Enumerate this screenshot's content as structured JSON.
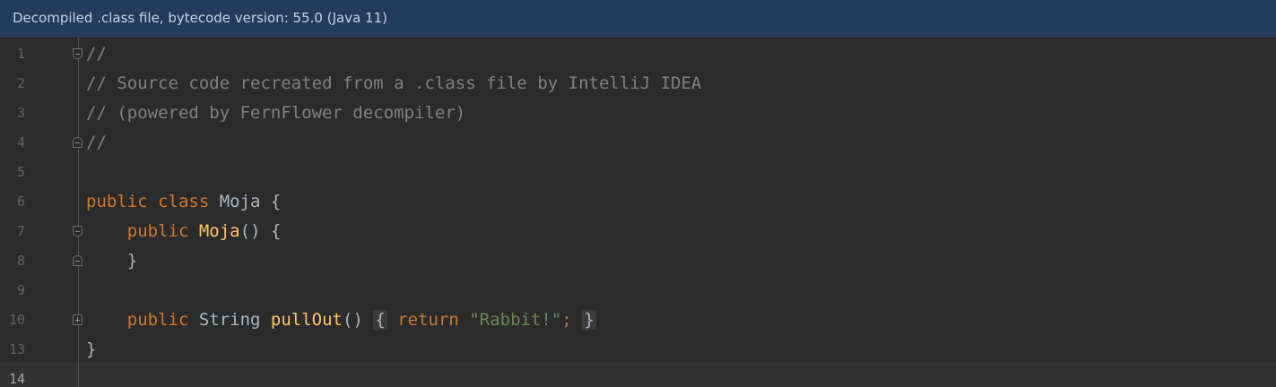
{
  "banner": {
    "text": "Decompiled .class file, bytecode version: 55.0 (Java 11)"
  },
  "editor": {
    "lines": [
      {
        "number": "1",
        "segments": [
          "//"
        ]
      },
      {
        "number": "2",
        "segments": [
          "// Source code recreated from a .class file by IntelliJ IDEA"
        ]
      },
      {
        "number": "3",
        "segments": [
          "// (powered by FernFlower decompiler)"
        ]
      },
      {
        "number": "4",
        "segments": [
          "//"
        ]
      },
      {
        "number": "5",
        "segments": []
      },
      {
        "number": "6",
        "segments": [
          "public class",
          " Moja {"
        ]
      },
      {
        "number": "7",
        "segments": [
          "    ",
          "public",
          " ",
          "Moja",
          "() {"
        ]
      },
      {
        "number": "8",
        "segments": [
          "    }"
        ]
      },
      {
        "number": "9",
        "segments": []
      },
      {
        "number": "10",
        "segments": [
          "    ",
          "public",
          " String ",
          "pullOut",
          "() ",
          "{",
          " ",
          "return",
          " ",
          "\"Rabbit!\"",
          ";",
          " ",
          "}"
        ]
      },
      {
        "number": "13",
        "segments": [
          "}"
        ]
      },
      {
        "number": "14",
        "segments": []
      }
    ]
  },
  "colors": {
    "banner_bg": "#233b5c",
    "editor_bg": "#2b2b2b",
    "comment": "#808080",
    "keyword": "#cc7832",
    "function": "#ffc66d",
    "string": "#6a8759",
    "text": "#a9b7c6"
  },
  "icons": {
    "fold_open": "fold-minus-icon",
    "fold_closed": "fold-plus-icon"
  }
}
